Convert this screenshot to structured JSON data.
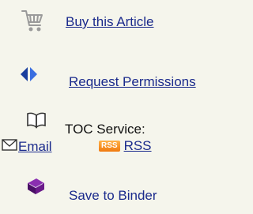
{
  "actions": {
    "buy_article": {
      "label": "Buy this Article",
      "icon": "shopping-cart-icon"
    },
    "request_permissions": {
      "label": "Request Permissions",
      "icon": "diamond-arrows-icon"
    },
    "toc_service": {
      "label": "TOC Service:",
      "icon": "open-book-icon",
      "email_label": "Email",
      "email_icon": "envelope-icon",
      "rss_badge": "RSS",
      "rss_label": "RSS"
    },
    "save_binder": {
      "label": "Save to Binder",
      "icon": "binder-book-icon"
    }
  },
  "colors": {
    "background": "#f5f5ec",
    "link": "#1a2a8c",
    "rss_badge": "#f08a1c",
    "permissions_blue": "#2a56c6",
    "binder_purple": "#6a1a8a"
  }
}
